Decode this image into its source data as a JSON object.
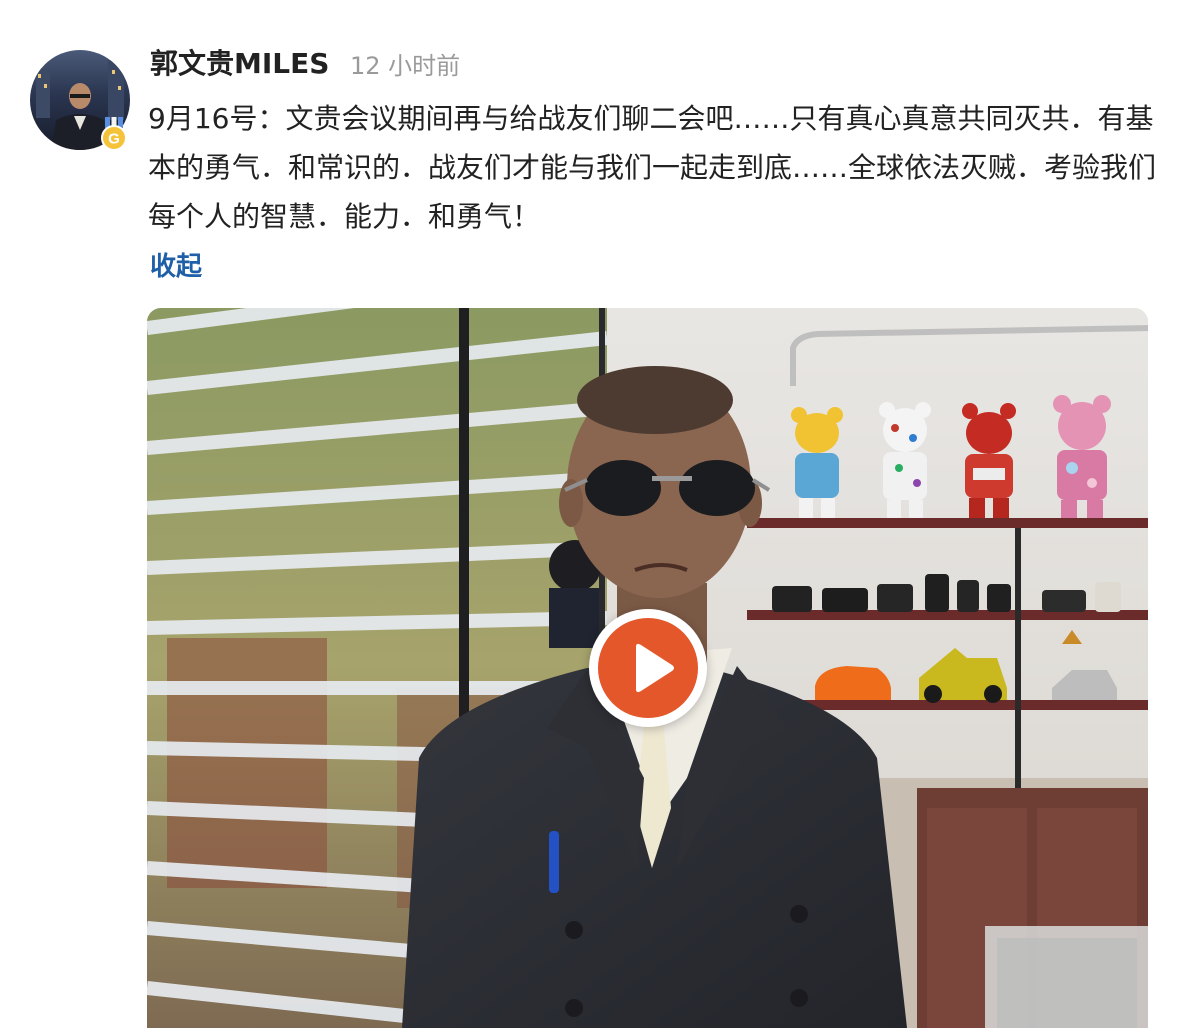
{
  "post": {
    "username": "郭文贵MILES",
    "timestamp": "12 小时前",
    "text": "9月16号：文贵会议期间再与给战友们聊二会吧……只有真心真意共同灭共．有基本的勇气．和常识的．战友们才能与我们一起走到底……全球依法灭贼．考验我们每个人的智慧．能力．和勇气！",
    "collapse_label": "收起"
  },
  "avatar": {
    "icon": "avatar",
    "badge_icon": "medal-badge-icon",
    "badge_letter": "G"
  },
  "video": {
    "play_icon": "play-icon"
  },
  "colors": {
    "link": "#1f5fa8",
    "timestamp": "#9a9a9a",
    "play_button": "#e3572b",
    "text": "#222222"
  }
}
